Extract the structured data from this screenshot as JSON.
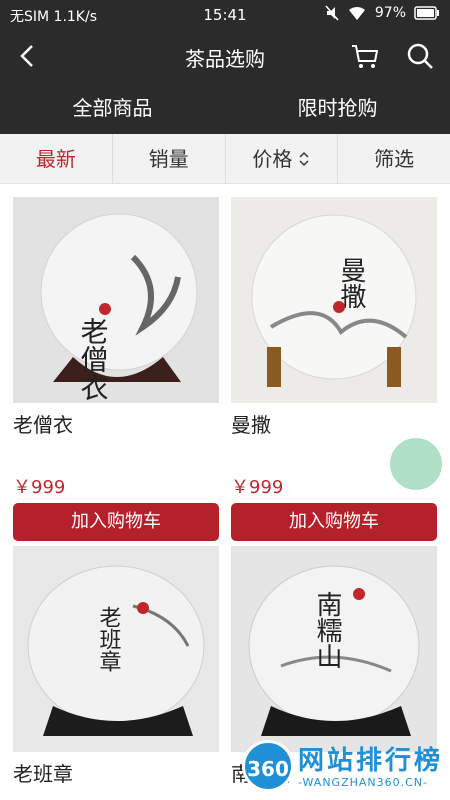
{
  "status_bar": {
    "carrier": "无SIM 1.1K/s",
    "time": "15:41",
    "battery": "97%"
  },
  "nav": {
    "title": "茶品选购"
  },
  "tabs": [
    {
      "label": "全部商品"
    },
    {
      "label": "限时抢购"
    }
  ],
  "sort": [
    {
      "label": "最新"
    },
    {
      "label": "销量"
    },
    {
      "label": "价格"
    },
    {
      "label": "筛选"
    }
  ],
  "products": [
    {
      "name": "老僧衣",
      "price": "￥999",
      "button": "加入购物车",
      "cake_text": "老僧衣"
    },
    {
      "name": "曼撒",
      "price": "￥999",
      "button": "加入购物车",
      "cake_text": "曼撒"
    },
    {
      "name": "老班章",
      "price": "",
      "button": "",
      "cake_text": "老班章"
    },
    {
      "name": "南糯山",
      "price": "",
      "button": "",
      "cake_text": "南糯山"
    }
  ],
  "watermark": {
    "badge": "360",
    "title": "网站排行榜",
    "subtitle": "-WANGZHAN360.CN-"
  },
  "colors": {
    "accent": "#c0272d",
    "button": "#b5212a",
    "header": "#2b2b2b"
  }
}
